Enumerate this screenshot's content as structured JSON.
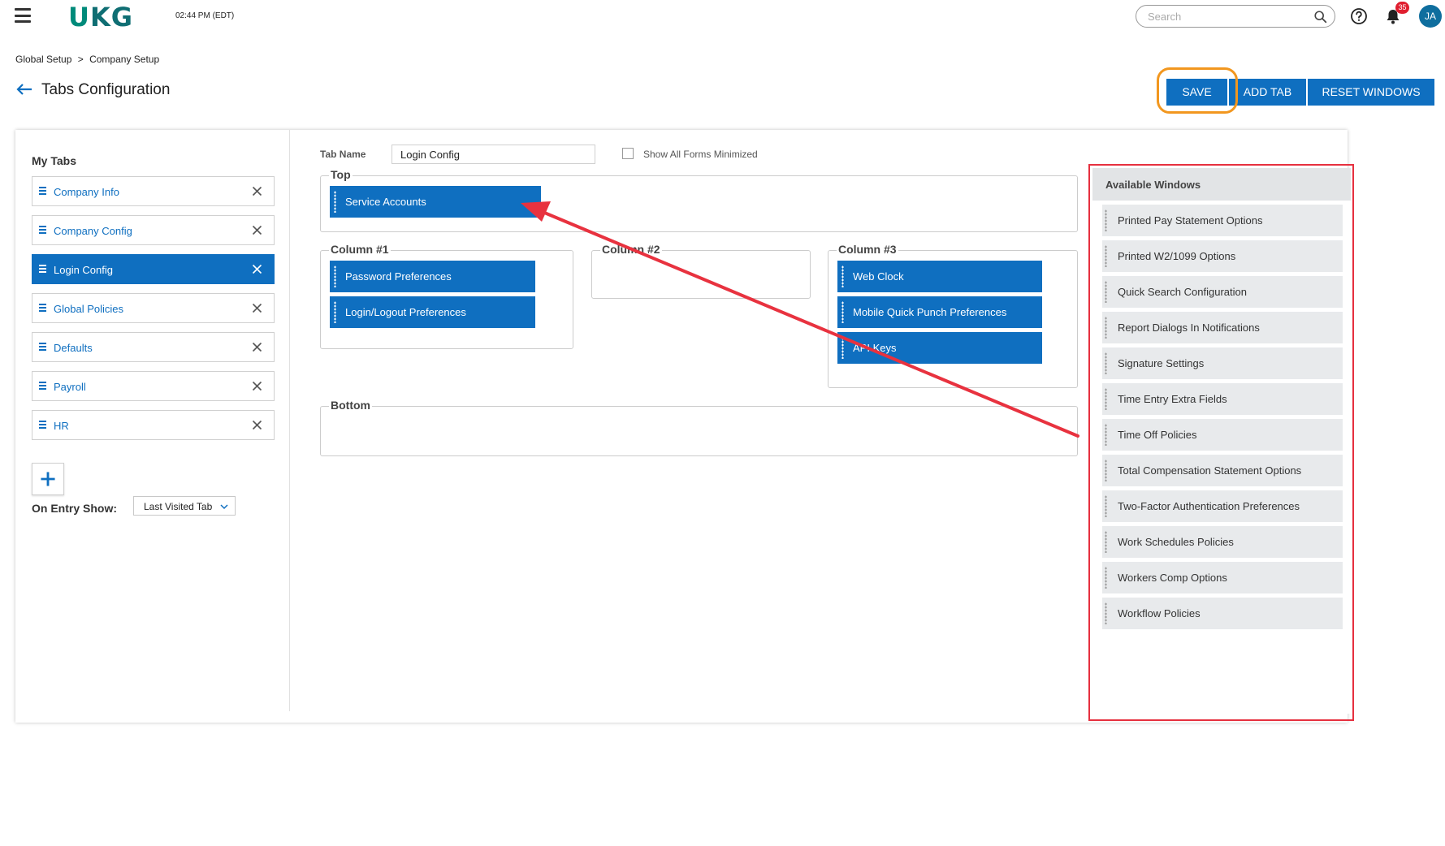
{
  "header": {
    "logo_text": "UKG",
    "clock": "02:44 PM (EDT)",
    "search_placeholder": "Search",
    "notification_count": "35",
    "avatar_initials": "JA"
  },
  "breadcrumb": {
    "items": [
      "Global Setup",
      ">",
      "Company Setup"
    ]
  },
  "page": {
    "title": "Tabs Configuration"
  },
  "actions": {
    "save": "SAVE",
    "add_tab": "ADD TAB",
    "reset_windows": "RESET WINDOWS"
  },
  "my_tabs": {
    "title": "My Tabs",
    "items": [
      {
        "label": "Company Info",
        "active": false
      },
      {
        "label": "Company Config",
        "active": false
      },
      {
        "label": "Login Config",
        "active": true
      },
      {
        "label": "Global Policies",
        "active": false
      },
      {
        "label": "Defaults",
        "active": false
      },
      {
        "label": "Payroll",
        "active": false
      },
      {
        "label": "HR",
        "active": false
      }
    ],
    "on_entry_label": "On Entry Show:",
    "on_entry_value": "Last Visited Tab"
  },
  "editor": {
    "tab_name_label": "Tab Name",
    "tab_name_value": "Login Config",
    "show_minimized_label": "Show All Forms Minimized",
    "show_minimized_checked": false,
    "zones": {
      "top": {
        "legend": "Top",
        "windows": [
          "Service Accounts"
        ]
      },
      "column1": {
        "legend": "Column #1",
        "windows": [
          "Password Preferences",
          "Login/Logout Preferences"
        ]
      },
      "column2": {
        "legend": "Column #2",
        "windows": []
      },
      "column3": {
        "legend": "Column #3",
        "windows": [
          "Web Clock",
          "Mobile Quick Punch Preferences",
          "API Keys"
        ]
      },
      "bottom": {
        "legend": "Bottom",
        "windows": []
      }
    }
  },
  "available_windows": {
    "title": "Available Windows",
    "items": [
      "Printed Pay Statement Options",
      "Printed W2/1099 Options",
      "Quick Search Configuration",
      "Report Dialogs In Notifications",
      "Signature Settings",
      "Time Entry Extra Fields",
      "Time Off Policies",
      "Total Compensation Statement Options",
      "Two-Factor Authentication Preferences",
      "Work Schedules Policies",
      "Workers Comp Options",
      "Workflow Policies"
    ]
  },
  "colors": {
    "primary": "#0f6fc0",
    "brand": "#008a7a",
    "highlight_save": "#f2971f",
    "highlight_panel": "#e6303f",
    "annotation_arrow": "#e8323f",
    "badge": "#e01e2f"
  },
  "icons": {
    "menu": "hamburger-icon",
    "search": "search-icon",
    "help": "help-icon",
    "notifications": "bell-icon",
    "back": "back-arrow-icon",
    "remove_tab": "close-icon",
    "add_tab": "plus-icon",
    "dropdown": "chevron-down-icon",
    "reorder": "drag-handle-icon"
  }
}
